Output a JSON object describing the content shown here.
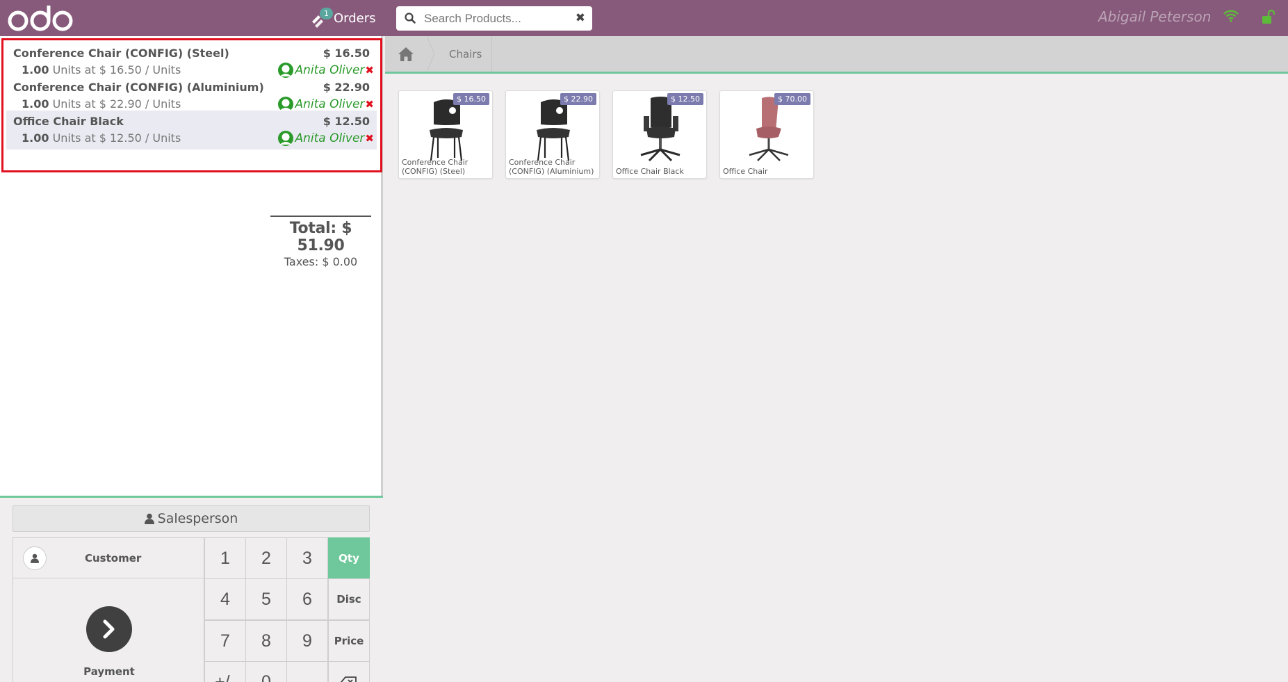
{
  "topbar": {
    "logo_text": "odoo",
    "orders_label": "Orders",
    "orders_count": "1",
    "search_placeholder": "Search Products...",
    "user_name": "Abigail Peterson",
    "icons": [
      "ticket-icon",
      "search-icon",
      "clear-icon",
      "wifi-icon",
      "lock-icon"
    ]
  },
  "order": {
    "lines": [
      {
        "name": "Conference Chair (CONFIG) (Steel)",
        "price": "$ 16.50",
        "qty": "1.00",
        "unit_info": "Units at $ 16.50 / Units",
        "salesperson": "Anita Oliver"
      },
      {
        "name": "Conference Chair (CONFIG) (Aluminium)",
        "price": "$ 22.90",
        "qty": "1.00",
        "unit_info": "Units at $ 22.90 / Units",
        "salesperson": "Anita Oliver"
      },
      {
        "name": "Office Chair Black",
        "price": "$ 12.50",
        "qty": "1.00",
        "unit_info": "Units at $ 12.50 / Units",
        "salesperson": "Anita Oliver"
      }
    ],
    "total": "Total: $ 51.90",
    "taxes": "Taxes: $ 0.00"
  },
  "pad": {
    "salesperson_label": "Salesperson",
    "customer_label": "Customer",
    "payment_label": "Payment",
    "keys": [
      "1",
      "2",
      "3",
      "4",
      "5",
      "6",
      "7",
      "8",
      "9",
      "+/-",
      "0",
      "."
    ],
    "modes": [
      "Qty",
      "Disc",
      "Price"
    ],
    "active_mode": "Qty",
    "colors": {
      "accent": "#6ec89b",
      "brand": "#875a7b"
    }
  },
  "breadcrumb": {
    "category": "Chairs"
  },
  "products": [
    {
      "name": "Conference Chair (CONFIG) (Steel)",
      "price": "$ 16.50"
    },
    {
      "name": "Conference Chair (CONFIG) (Aluminium)",
      "price": "$ 22.90"
    },
    {
      "name": "Office Chair Black",
      "price": "$ 12.50"
    },
    {
      "name": "Office Chair",
      "price": "$ 70.00"
    }
  ]
}
